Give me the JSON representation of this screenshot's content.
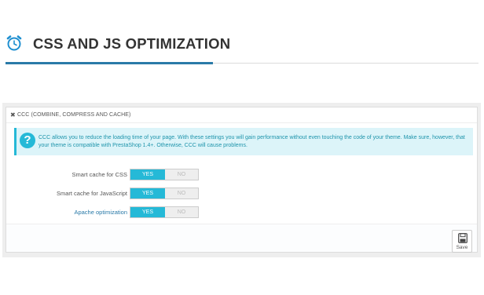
{
  "page": {
    "title": "CSS AND JS OPTIMIZATION",
    "header_icon": "alarm-clock-icon",
    "accent_color": "#2a7aa8"
  },
  "panel": {
    "heading_icon": "shrink-arrows-icon",
    "heading": "CCC (COMBINE, COMPRESS AND CACHE)",
    "alert": {
      "icon": "question-circle-icon",
      "text": "CCC allows you to reduce the loading time of your page. With these settings you will gain performance without even touching the code of your theme. Make sure, however, that your theme is compatible with PrestaShop 1.4+. Otherwise, CCC will cause problems.",
      "color": "#25b9d7"
    },
    "settings": [
      {
        "label": "Smart cache for CSS",
        "yes": "YES",
        "no": "NO",
        "value": "YES"
      },
      {
        "label": "Smart cache for JavaScript",
        "yes": "YES",
        "no": "NO",
        "value": "YES"
      },
      {
        "label": "Apache optimization",
        "yes": "YES",
        "no": "NO",
        "value": "YES"
      }
    ],
    "save": {
      "label": "Save",
      "icon": "floppy-disk-icon"
    }
  }
}
